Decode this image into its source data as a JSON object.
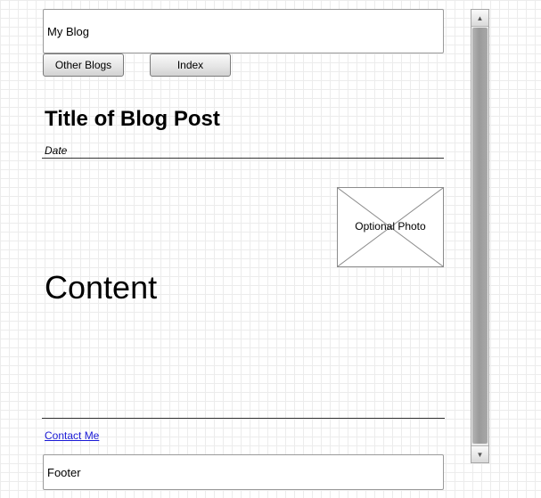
{
  "header": {
    "title": "My Blog"
  },
  "nav": {
    "other_blogs_label": "Other Blogs",
    "index_label": "Index"
  },
  "post": {
    "title": "Title of Blog Post",
    "date": "Date",
    "photo_label": "Optional Photo",
    "content": "Content"
  },
  "links": {
    "contact": "Contact Me"
  },
  "footer": {
    "text": "Footer"
  },
  "scrollbar": {
    "up_icon": "triangle-up-icon",
    "down_icon": "triangle-down-icon"
  },
  "colors": {
    "link": "#1a1ad6",
    "border": "#9a9a9a",
    "grid": "#ececec"
  }
}
